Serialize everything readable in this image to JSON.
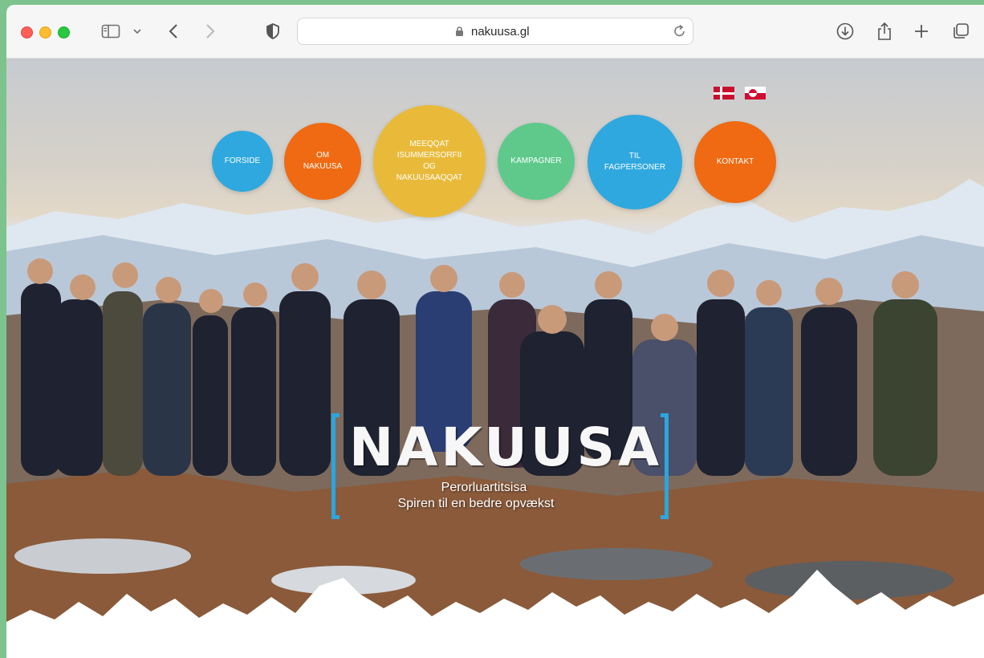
{
  "browser": {
    "url": "nakuusa.gl"
  },
  "languages": [
    {
      "code": "da",
      "icon": "danish-flag-icon"
    },
    {
      "code": "kl",
      "icon": "greenlandic-flag-icon"
    }
  ],
  "nav": {
    "forside": "FORSIDE",
    "om": "OM\nNAKUUSA",
    "meeqqat": "MEEQQAT\nISUMMERSORFII\nOG\nNAKUUSAAQQAT",
    "kampagner": "KAMPAGNER",
    "fagpersoner": "TIL\nFAGPERSONER",
    "kontakt": "KONTAKT"
  },
  "colors": {
    "blue": "#2fa8df",
    "orange": "#ef6a12",
    "yellow": "#e9ba3a",
    "green": "#5ec98b"
  },
  "logo": {
    "word": "NAKUUSA",
    "tagline_1": "Perorluartitsisa",
    "tagline_2": "Spiren til en bedre opvækst"
  }
}
